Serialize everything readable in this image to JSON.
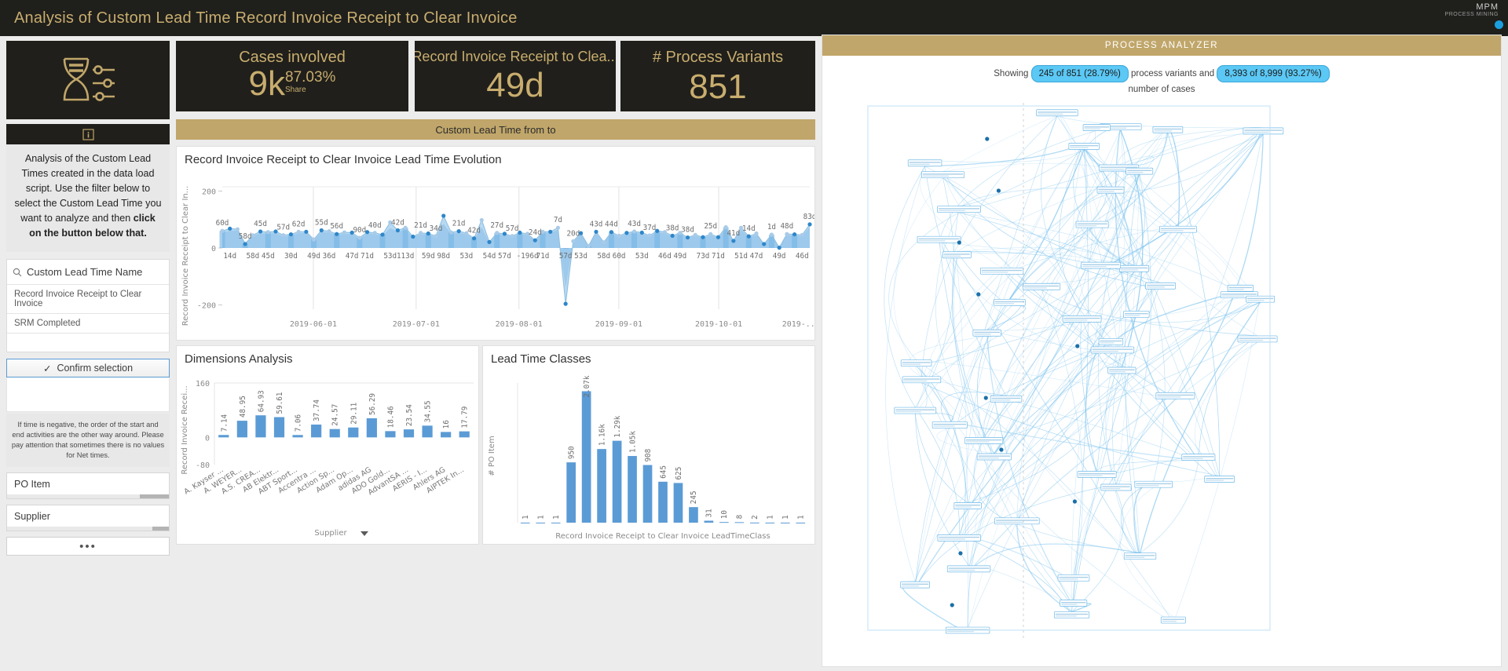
{
  "titlebar": {
    "title": "Analysis of Custom Lead Time Record Invoice Receipt to Clear Invoice",
    "logo_main": "MPM",
    "logo_sub": "PROCESS MINING"
  },
  "left": {
    "hourglass_icon": "hourglass-slider-icon",
    "info_icon": "info-icon",
    "info_text_1": "Analysis of the Custom Lead Times created in the data load script. Use the filter below to select the Custom Lead Time you want to analyze and then ",
    "info_text_bold": "click on the button below that.",
    "filter_title": "Custom Lead Time Name",
    "filter_options": [
      "Record Invoice Receipt to Clear Invoice",
      "SRM Completed"
    ],
    "confirm_label": "Confirm selection",
    "note": "If time is negative, the order of the start and end activities are the other way around.\nPlease pay attention that sometimes there is no values for Net times.",
    "listboxes": [
      {
        "label": "PO Item",
        "fill": 0.18
      },
      {
        "label": "Supplier",
        "fill": 0.1
      }
    ],
    "more_label": "•••"
  },
  "kpis": [
    {
      "title": "Cases involved",
      "value": "9k",
      "share_pct": "87.03%",
      "share_label": "Share"
    },
    {
      "title": "Record Invoice Receipt to Clea...",
      "value": "49d"
    },
    {
      "title": "# Process Variants",
      "value": "851"
    }
  ],
  "goldband_label": "Custom Lead Time from to",
  "chart_data": [
    {
      "type": "area",
      "title": "Record Invoice Receipt to Clear Invoice Lead Time Evolution",
      "ylabel": "Record Invoice Receipt to Clear In...",
      "xlabel": "",
      "ylim": [
        -200,
        200
      ],
      "yticks": [
        200,
        0,
        -200
      ],
      "xticks": [
        "2019-06-01",
        "2019-07-01",
        "2019-08-01",
        "2019-09-01",
        "2019-10-01",
        "2019-..."
      ],
      "point_labels": [
        "60d",
        "14d",
        "58d",
        "58d",
        "45d",
        "45d",
        "57d",
        "30d",
        "62d",
        "49d",
        "55d",
        "36d",
        "56d",
        "47d",
        "90d",
        "71d",
        "40d",
        "53d",
        "42d",
        "113d",
        "21d",
        "59d",
        "34d",
        "98d",
        "21d",
        "53d",
        "42d",
        "54d",
        "27d",
        "57d",
        "57d",
        "-196d",
        "24d",
        "71d",
        "7d",
        "57d",
        "20d",
        "53d",
        "43d",
        "58d",
        "44d",
        "60d",
        "43d",
        "53d",
        "37d",
        "46d",
        "38d",
        "49d",
        "38d",
        "73d",
        "25d",
        "71d",
        "41d",
        "51d",
        "14d",
        "47d",
        "1d",
        "49d",
        "48d",
        "46d",
        "83d"
      ],
      "values": [
        60,
        68,
        66,
        14,
        45,
        58,
        56,
        58,
        45,
        48,
        57,
        57,
        30,
        62,
        59,
        49,
        55,
        54,
        36,
        56,
        53,
        47,
        90,
        62,
        71,
        40,
        53,
        51,
        42,
        113,
        55,
        59,
        52,
        34,
        98,
        21,
        53,
        50,
        42,
        54,
        50,
        27,
        57,
        57,
        71,
        -196,
        24,
        52,
        7,
        57,
        20,
        56,
        43,
        53,
        58,
        54,
        44,
        60,
        56,
        43,
        53,
        37,
        46,
        38,
        49,
        38,
        73,
        25,
        71,
        41,
        51,
        14,
        47,
        1,
        49,
        48,
        46,
        83
      ],
      "secondary_values": [
        55,
        60,
        62,
        20,
        42,
        52,
        50,
        53,
        40,
        44,
        52,
        53,
        28,
        57,
        54,
        46,
        50,
        49,
        33,
        52,
        48,
        44,
        70,
        58,
        64,
        37,
        49,
        47,
        39,
        85,
        50,
        54,
        48,
        31,
        72,
        19,
        49,
        46,
        39,
        50,
        46,
        25,
        53,
        53,
        64,
        -140,
        22,
        48,
        10,
        52,
        19,
        51,
        40,
        49,
        53,
        50,
        41,
        55,
        51,
        40,
        49,
        34,
        43,
        35,
        45,
        35,
        66,
        23,
        64,
        38,
        47,
        13,
        43,
        5,
        45,
        44,
        42,
        74
      ]
    },
    {
      "type": "bar",
      "title": "Dimensions Analysis",
      "ylabel": "Record Invoice Recei...",
      "xlabel": "Supplier",
      "ylim": [
        -80,
        160
      ],
      "yticks": [
        160,
        0,
        -80
      ],
      "categories": [
        "A. Kayser ...",
        "A. WEYER...",
        "A.S. CREA...",
        "AB Elektr...",
        "ABT Sport...",
        "Accentra ...",
        "Action Sp...",
        "Adam Op...",
        "adidas AG",
        "ADO Gold...",
        "AdvantSA ...",
        "AERIS - I...",
        "Ahlers AG",
        "AIPTEK In..."
      ],
      "values": [
        7.14,
        48.95,
        64.93,
        59.61,
        7.06,
        37.74,
        24.57,
        29.11,
        56.29,
        18.46,
        23.54,
        34.55,
        16,
        17.79
      ],
      "legend_label": "Supplier"
    },
    {
      "type": "bar",
      "title": "Lead Time Classes",
      "ylabel": "# PO Item",
      "xlabel": "Record Invoice Receipt to Clear Invoice LeadTimeClass",
      "categories": [
        "",
        "",
        "",
        "",
        "",
        "",
        "",
        "",
        "",
        "",
        "",
        "",
        "",
        "",
        "",
        "",
        ""
      ],
      "value_labels": [
        "1",
        "1",
        "1",
        "950",
        "2.07k",
        "1.16k",
        "1.29k",
        "1.05k",
        "908",
        "645",
        "625",
        "245",
        "31",
        "10",
        "8",
        "2",
        "1",
        "1",
        "1"
      ],
      "values": [
        1,
        1,
        1,
        950,
        2070,
        1160,
        1290,
        1050,
        908,
        645,
        625,
        245,
        31,
        10,
        8,
        2,
        1,
        1,
        1
      ]
    }
  ],
  "rail_icons": [
    "info-icon",
    "fullscreen-icon",
    "zoom-in-icon",
    "zoom-out-icon",
    "zoom-fit-icon",
    "target-icon",
    "flag-icon",
    "eye-icon",
    "eye-dim-icon",
    "eye-slash-icon",
    "layers-icon",
    "footprint-icon",
    "checkbox-icon",
    "circle-target-icon"
  ],
  "process_analyzer": {
    "header": "PROCESS ANALYZER",
    "showing_prefix": "Showing",
    "variants_pill": "245 of 851 (28.79%)",
    "mid_text": "process variants and",
    "cases_pill": "8,393 of 8,999 (93.27%)",
    "tail_text": "number of cases"
  },
  "colors": {
    "gold": "#c0a66a",
    "dark": "#201f1b",
    "blue": "#5b9bd5",
    "accent_blue": "#5bc8f5"
  }
}
